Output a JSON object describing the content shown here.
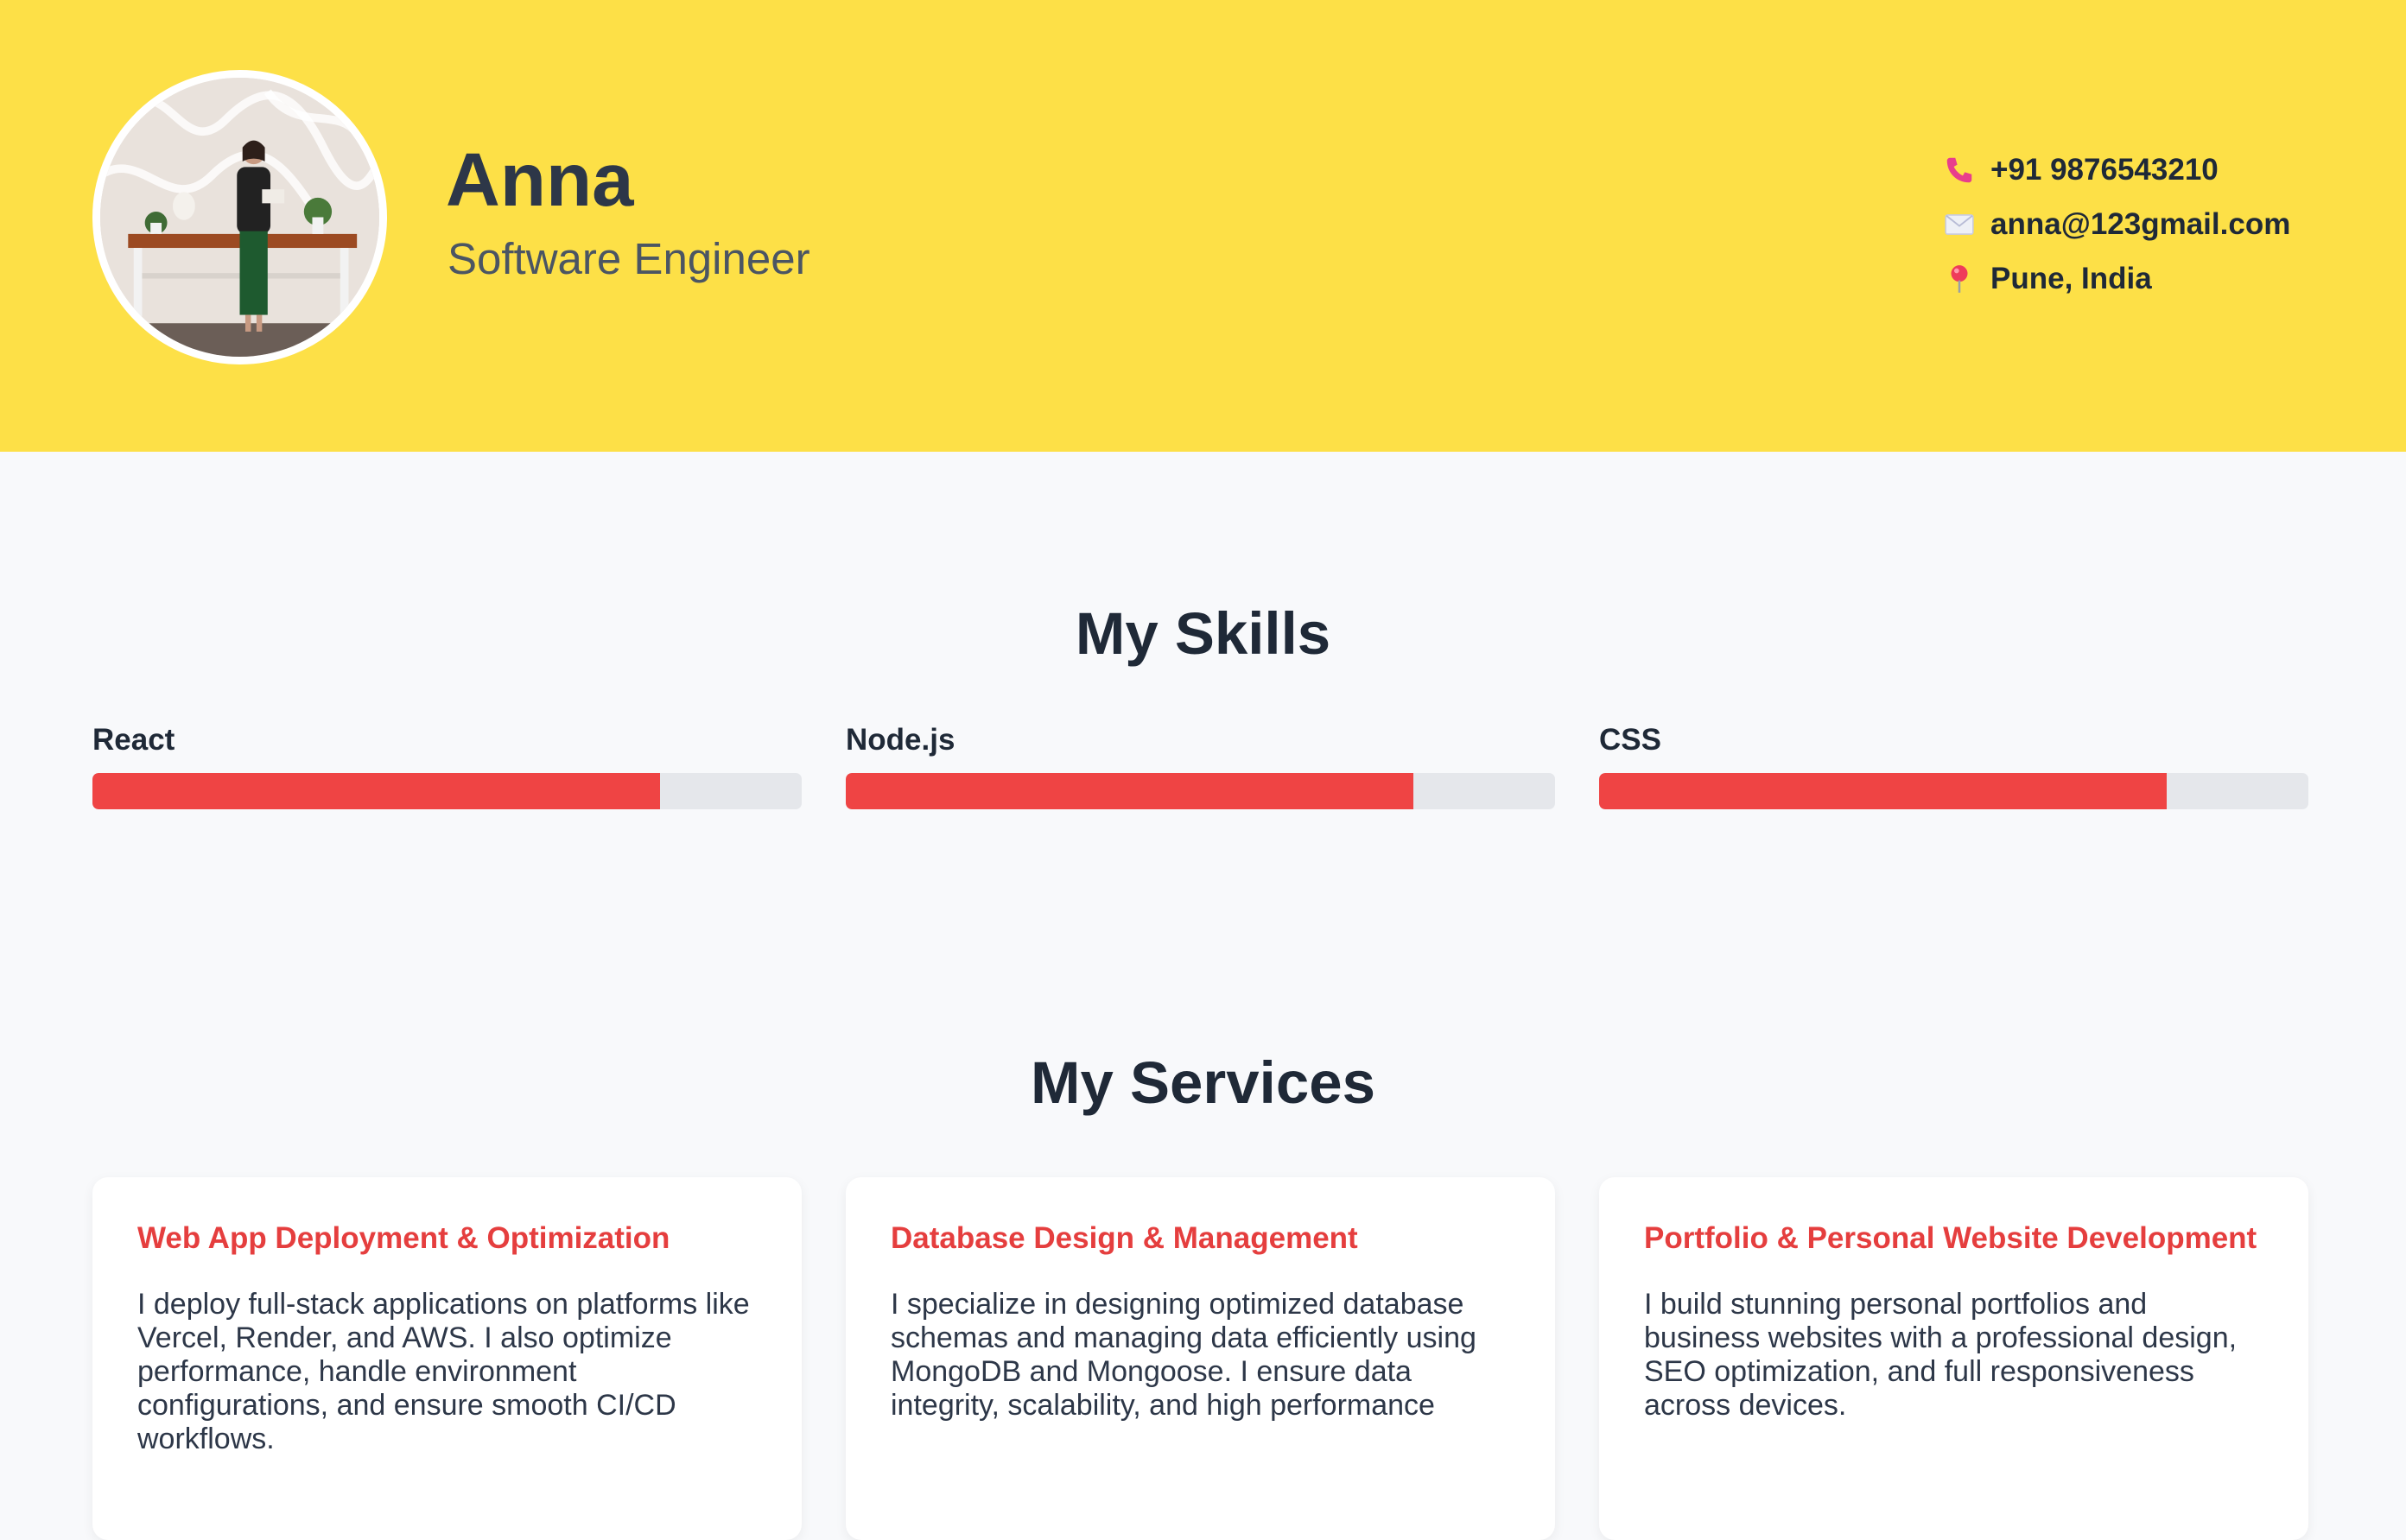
{
  "profile": {
    "name": "Anna",
    "role": "Software Engineer"
  },
  "contact": {
    "phone": "+91 9876543210",
    "email": "anna@123gmail.com",
    "location": "Pune, India",
    "icons": [
      "phone-icon",
      "envelope-icon",
      "pin-icon"
    ]
  },
  "skills": {
    "title": "My Skills",
    "items": [
      {
        "label": "React",
        "level": 0.8
      },
      {
        "label": "Node.js",
        "level": 0.8
      },
      {
        "label": "CSS",
        "level": 0.8
      }
    ]
  },
  "services": {
    "title": "My Services",
    "items": [
      {
        "title": "Web App Deployment & Optimization",
        "description": "I deploy full-stack applications on platforms like Vercel, Render, and AWS. I also optimize performance, handle environment configurations, and ensure smooth CI/CD workflows."
      },
      {
        "title": "Database Design & Management",
        "description": "I specialize in designing optimized database schemas and managing data efficiently using MongoDB and Mongoose. I ensure data integrity, scalability, and high performance"
      },
      {
        "title": "Portfolio & Personal Website Development",
        "description": "I build stunning personal portfolios and business websites with a professional design, SEO optimization, and full responsiveness across devices."
      }
    ]
  },
  "colors": {
    "header_bg": "#fde047",
    "accent": "#ef4444",
    "track": "#e5e7eb",
    "page_bg": "#f8f9fb"
  }
}
